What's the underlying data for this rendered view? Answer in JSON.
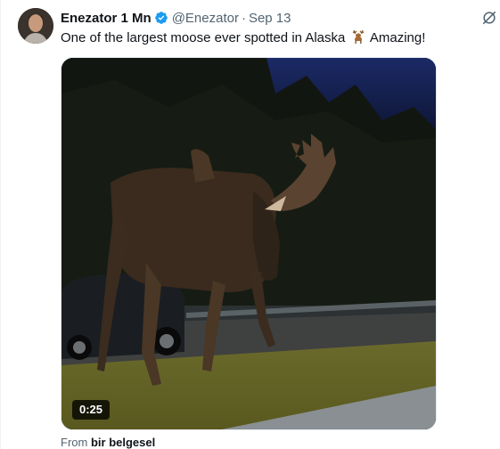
{
  "tweet": {
    "author_name": "Enezator 1 Mn",
    "handle": "@Enezator",
    "separator": "·",
    "date": "Sep 13",
    "text_before_emoji": "One of the largest moose ever spotted in Alaska",
    "emoji": "deer-emoji",
    "text_after_emoji": "Amazing!",
    "video_duration": "0:25",
    "source_prefix": "From",
    "source_name": "bir belgesel"
  },
  "icons": {
    "verified": "verified-badge-icon",
    "grok": "grok-icon"
  },
  "colors": {
    "verified_blue": "#1d9bf0",
    "secondary_text": "#536471"
  }
}
